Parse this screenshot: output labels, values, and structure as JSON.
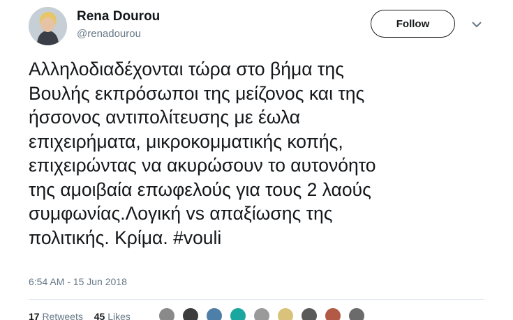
{
  "author": {
    "display_name": "Rena Dourou",
    "handle": "@renadourou"
  },
  "follow_button": {
    "label": "Follow"
  },
  "tweet": {
    "lines": [
      "Αλληλοδιαδέχονται τώρα στο βήμα της",
      "Βουλής εκπρόσωποι της μείζονος και της",
      "ήσσονος αντιπολίτευσης με έωλα",
      "επιχειρήματα, μικροκομματικής κοπής,",
      "επιχειρώντας να ακυρώσουν το αυτονόητο",
      "της αμοιβαία επωφελούς για τους 2 λαούς",
      "συμφωνίας.Λογική vs απαξίωσης της",
      "πολιτικής. Κρίμα. "
    ],
    "hashtag": "#vouli",
    "timestamp": "6:54 AM - 15 Jun 2018"
  },
  "stats": {
    "retweets_count": "17",
    "retweets_label": "Retweets",
    "likes_count": "45",
    "likes_label": "Likes"
  },
  "liker_avatar_colors": [
    "#8a8a8a",
    "#3c3c3c",
    "#4e7fa8",
    "#1aa7a0",
    "#9a9a9a",
    "#d9c27a",
    "#5a5a5a",
    "#b35a46",
    "#6b6b6b"
  ]
}
